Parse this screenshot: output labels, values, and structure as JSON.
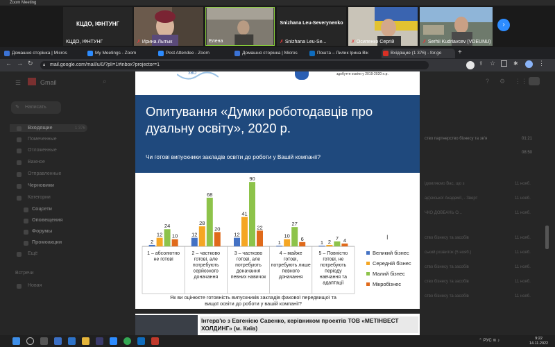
{
  "zoom": {
    "app_title": "Zoom Meeting",
    "participants": [
      {
        "name": "КЦДО, ІФНТУНГ",
        "muted": false,
        "video": false
      },
      {
        "name": "Ирина Лытык",
        "muted": true,
        "video": true
      },
      {
        "name": "Елена",
        "muted": false,
        "video": true
      },
      {
        "name": "Snizhana Leu-Se...",
        "muted": true,
        "video": false
      },
      {
        "name": "Осипенко Сергій",
        "muted": true,
        "video": true
      },
      {
        "name": "Serhii Kudriavcev (VDEUNU)",
        "muted": true,
        "video": true
      }
    ],
    "inline_names": [
      "КЦДО, ІФНТУНГ",
      "Snizhana Leu-Severynenko"
    ],
    "next_icon": "chevron-right-icon"
  },
  "browser": {
    "tabs": [
      {
        "label": "Домашня сторінка | Micros",
        "active": false,
        "color": "#3b73d6"
      },
      {
        "label": "My Meetings - Zoom",
        "active": false,
        "color": "#2d8cff"
      },
      {
        "label": "Post Attendee - Zoom",
        "active": false,
        "color": "#2d8cff"
      },
      {
        "label": "Домашня сторінка | Micros",
        "active": false,
        "color": "#3b73d6"
      },
      {
        "label": "Пошта – Лилик Ірина Вік",
        "active": false,
        "color": "#0f6cbd"
      },
      {
        "label": "Вхідящие (1 376) - for.go",
        "active": true,
        "color": "#d93025"
      }
    ],
    "new_tab": "+",
    "url": "mail.google.com/mail/u/0/?pli=1#inbox?projector=1",
    "nav": {
      "back": "←",
      "forward": "→",
      "reload": "↻"
    }
  },
  "gmail": {
    "brand": "Gmail",
    "compose": "Написать",
    "sidebar": [
      {
        "label": "Входящие",
        "count": "1 376",
        "bold": true
      },
      {
        "label": "Помеченные"
      },
      {
        "label": "Отложенные"
      },
      {
        "label": "Важное"
      },
      {
        "label": "Отправленные"
      },
      {
        "label": "Черновики",
        "count": "",
        "bold": true
      },
      {
        "label": "Категории"
      },
      {
        "label": "Соцсети",
        "bold": true
      },
      {
        "label": "Оповещения",
        "bold": true
      },
      {
        "label": "Форумы",
        "bold": true
      },
      {
        "label": "Промоакции",
        "bold": true
      },
      {
        "label": "Ещё"
      }
    ],
    "meet_section": "Встречи",
    "meet_new": "Новая",
    "right_rows": [
      {
        "text": "ство бізнесу та зв'я",
        "time": "01:21"
      },
      {
        "text": "",
        "time": "08:50"
      },
      {
        "text": "ідомляємо Вас, що з",
        "time": "11 нояб."
      },
      {
        "text": "ад'єкської Академії, - Зверт",
        "time": "11 нояб."
      },
      {
        "text": "ЧКО ДОВБАНЬ О...",
        "time": "11 нояб."
      },
      {
        "text": "ство бізнесу та засобів",
        "time": "11 нояб."
      },
      {
        "text": "ський розвиток (5 нояб.)",
        "time": "11 нояб."
      },
      {
        "text": "ство бізнесу та засобів",
        "time": "11 нояб."
      },
      {
        "text": "ство бізнесу та засобів",
        "time": "11 нояб."
      },
      {
        "text": "ство бізнесу та засобів",
        "time": "11 нояб."
      }
    ],
    "top_partial": "ство партнерство бізнесу та зв'я"
  },
  "slide": {
    "header_caption": "здобуття освіти у 2019-2020 н.р.",
    "logo_text": "ЗВО",
    "title": "Опитування  «Думки роботодавців про дуальну освіту»,  2020 р.",
    "question": "Чи готові випускники закладів освіти до роботи у Вашій компанії?",
    "bottom_question": "Як ви оцінюєте готовність випускників закладів фахової передвищої та вищої освіти до роботи у вашій компанії?"
  },
  "chart_data": {
    "type": "bar",
    "title": "",
    "categories": [
      "1 – абсолютно не готові",
      "2 – частково готові, але потребують серйозного доначання",
      "3 – частково готові, але потребують доначання певних навичок",
      "4 – майже готові, потребують лише певного доначання",
      "5 – Повністю готові, не потребують періоду навчання та адаптації"
    ],
    "series": [
      {
        "name": "Великий бізнес",
        "values": [
          2,
          12,
          12,
          1,
          1
        ],
        "color": "#4472c4"
      },
      {
        "name": "Середній бізнес",
        "values": [
          12,
          28,
          41,
          10,
          2
        ],
        "color": "#f5a623"
      },
      {
        "name": "Малий бізнес",
        "values": [
          24,
          68,
          90,
          27,
          7
        ],
        "color": "#8dc34a"
      },
      {
        "name": "Мікробізнес",
        "values": [
          10,
          20,
          22,
          6,
          4
        ],
        "color": "#e06a1b"
      }
    ],
    "ylim": [
      0,
      95
    ],
    "legend": "right"
  },
  "slide2": {
    "text": "Інтерв'ю з Евгенією Савенко, керівником проектів ТОВ «МЕТІНВЕСТ ХОЛДИНГ» (м. Київ)"
  },
  "taskbar": {
    "lang": "РУС",
    "time": "9:22",
    "date": "14.11.2022"
  }
}
